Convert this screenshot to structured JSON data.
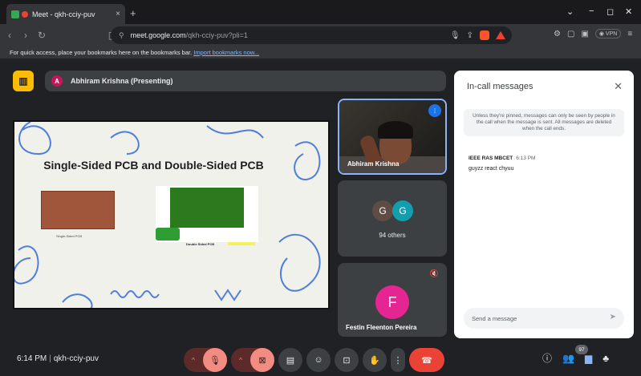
{
  "browser": {
    "tab_title": "Meet - qkh-cciy-puv",
    "tab_close": "×",
    "new_tab": "+",
    "win_min": "−",
    "win_max": "◻",
    "win_close": "✕",
    "url_host": "meet.google.com",
    "url_path": "/qkh-cciy-puv?pli=1",
    "vpn_label": "◉ VPN",
    "bookmarks_text": "For quick access, place your bookmarks here on the bookmarks bar.",
    "bookmarks_link": "Import bookmarks now..."
  },
  "meeting": {
    "presenter_initial": "A",
    "presenter_label": "Abhiram Krishna (Presenting)",
    "slide": {
      "title": "Single-Sided PCB and Double-Sided PCB",
      "left_caption": "Single-Sided PCB",
      "right_caption": "Double Sided PCB"
    },
    "tiles": {
      "speaker_name": "Abhiram Krishna",
      "others_initials": [
        "G",
        "G"
      ],
      "others_label": "94 others",
      "festin_initial": "F",
      "festin_name": "Festin Fleenton Pereira"
    }
  },
  "chat": {
    "title": "In-call messages",
    "close": "✕",
    "note": "Unless they're pinned, messages can only be seen by people in the call when the message is sent. All messages are deleted when the call ends.",
    "messages": [
      {
        "sender": "IEEE RAS MBCET",
        "time": "6:13 PM",
        "text": "guyzz react chyuu"
      }
    ],
    "input_placeholder": "Send a message"
  },
  "bottom_bar": {
    "time": "6:14 PM",
    "separator": "|",
    "meeting_code": "qkh-cciy-puv",
    "people_count": "97"
  },
  "colors": {
    "accent_blue": "#1a73e8",
    "end_call_red": "#ea4335",
    "presenting_yellow": "#fbbc04",
    "avatar_pink": "#e52592"
  }
}
